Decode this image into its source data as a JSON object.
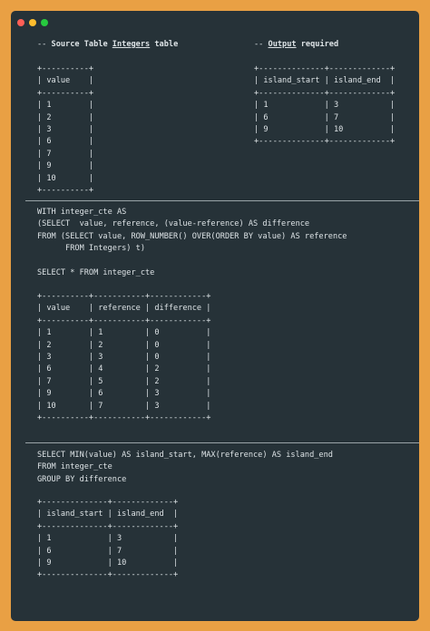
{
  "window": {
    "controls": [
      "close",
      "minimize",
      "maximize"
    ]
  },
  "source_heading": {
    "prefix": "-- ",
    "pre": "Source Table ",
    "name": "Integers",
    "post": " table"
  },
  "output_heading": {
    "prefix": "-- ",
    "name": "Output",
    "post": " required"
  },
  "source_table": "+----------+\n| value    |\n+----------+\n| 1        |\n| 2        |\n| 3        |\n| 6        |\n| 7        |\n| 9        |\n| 10       |\n+----------+",
  "output_table": "+--------------+-------------+\n| island_start | island_end  |\n+--------------+-------------+\n| 1            | 3           |\n| 6            | 7           |\n| 9            | 10          |\n+--------------+-------------+",
  "query1": "WITH integer_cte AS\n(SELECT  value, reference, (value-reference) AS difference\nFROM (SELECT value, ROW_NUMBER() OVER(ORDER BY value) AS reference\n      FROM Integers) t)\n\nSELECT * FROM integer_cte",
  "cte_table": "+----------+-----------+------------+\n| value    | reference | difference |\n+----------+-----------+------------+\n| 1        | 1         | 0          |\n| 2        | 2         | 0          |\n| 3        | 3         | 0          |\n| 6        | 4         | 2          |\n| 7        | 5         | 2          |\n| 9        | 6         | 3          |\n| 10       | 7         | 3          |\n+----------+-----------+------------+",
  "query2": "SELECT MIN(value) AS island_start, MAX(reference) AS island_end\nFROM integer_cte\nGROUP BY difference",
  "result_table": "+--------------+-------------+\n| island_start | island_end  |\n+--------------+-------------+\n| 1            | 3           |\n| 6            | 7           |\n| 9            | 10          |\n+--------------+-------------+"
}
